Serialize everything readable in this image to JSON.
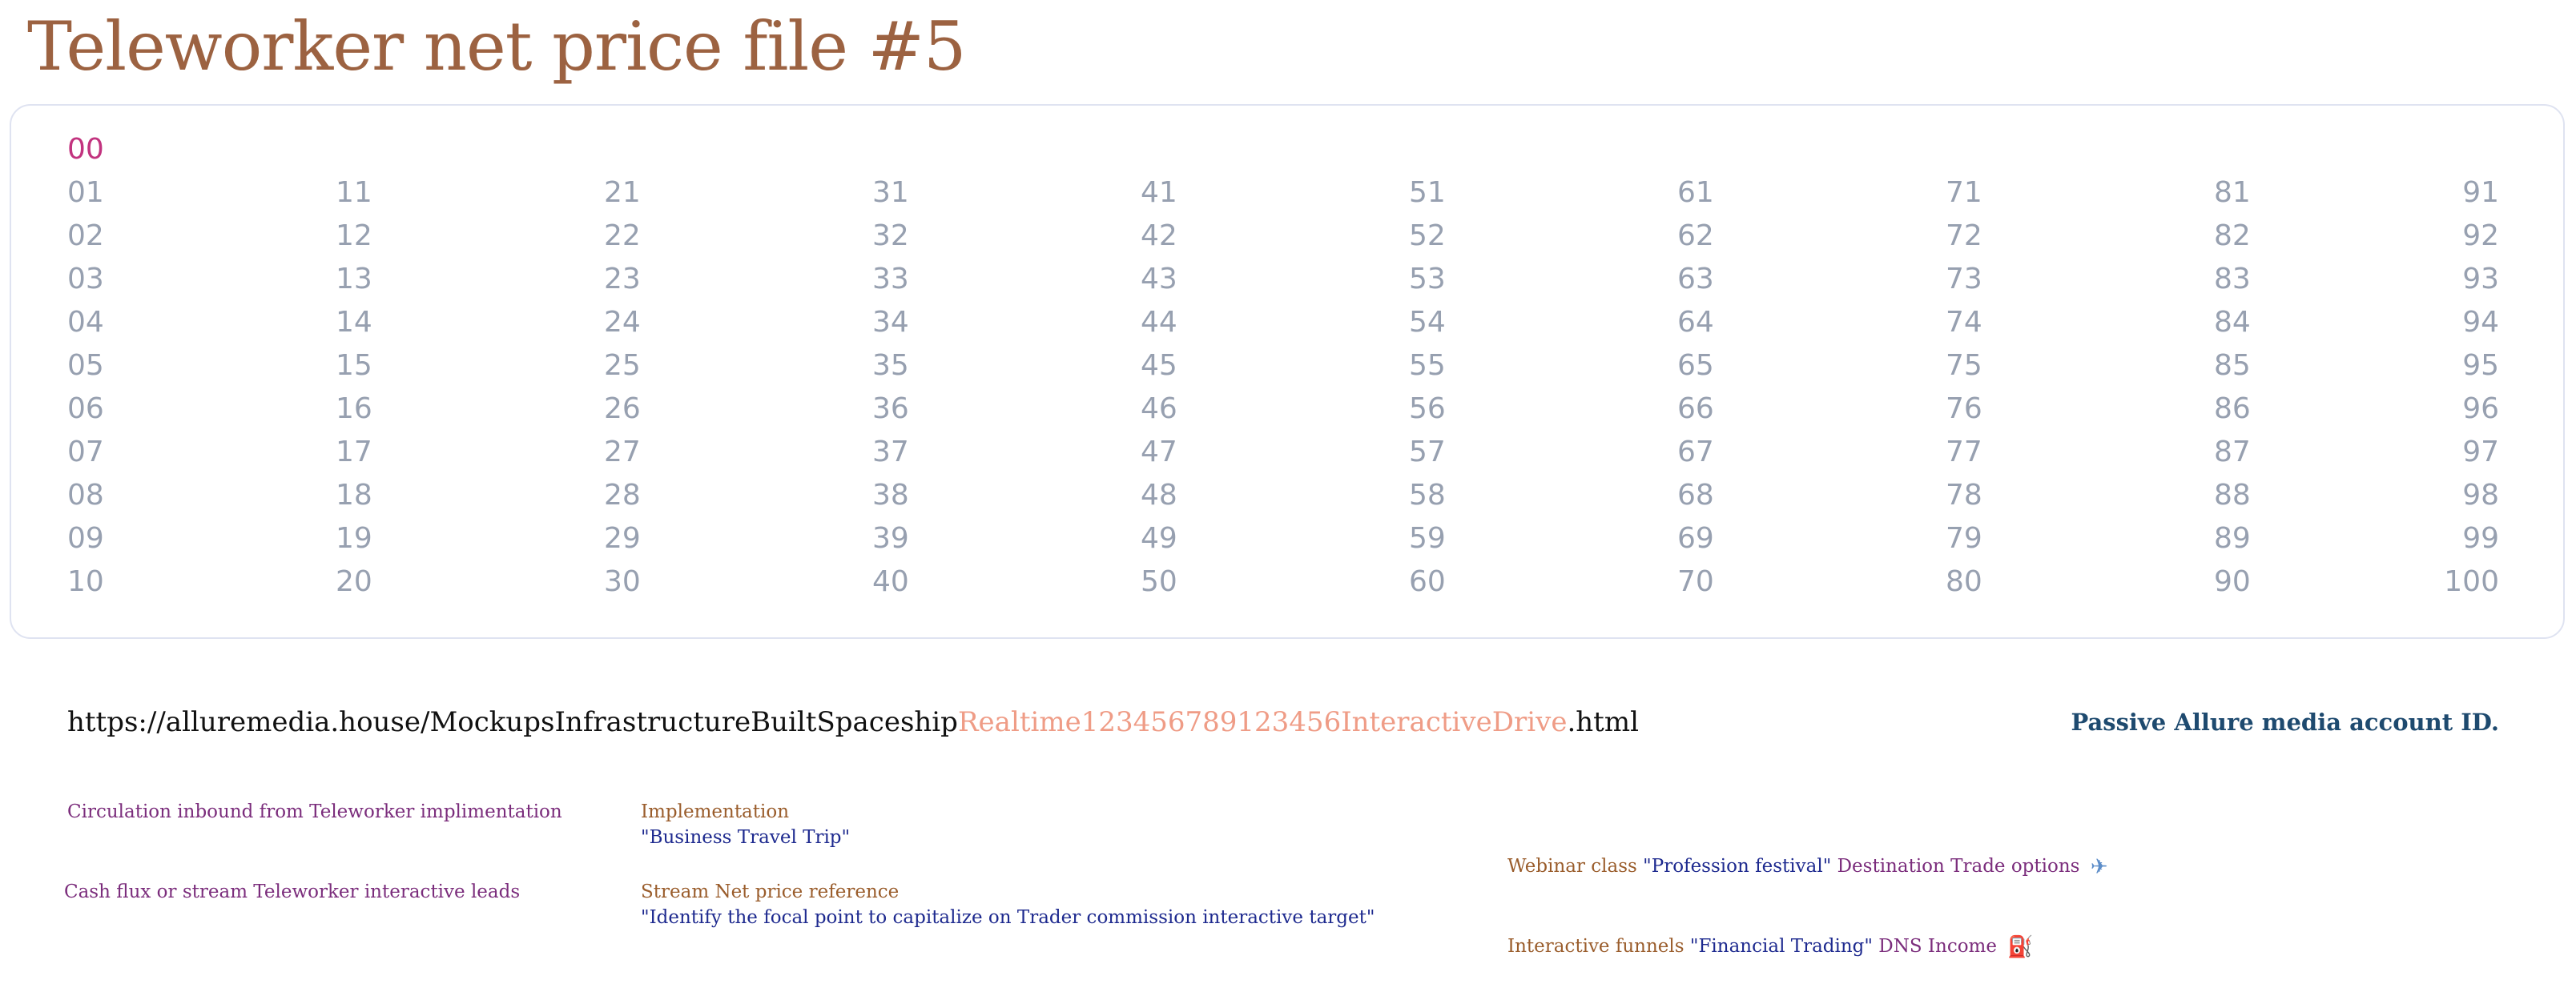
{
  "page": {
    "title": "Teleworker net price file #5"
  },
  "colors": {
    "title": "#9c6241",
    "highlight_number": "#c2337f",
    "number": "#97a0b0",
    "card_border": "#dfe3f1",
    "url_text": "#111111",
    "url_highlight": "#ef9c86",
    "account_link": "#1e4a6f",
    "purple": "#7b2d7c",
    "brown": "#9a5d2c",
    "navy": "#1e2a8f",
    "emoji_red": "#c8282f",
    "emoji_blue": "#5c8dc9"
  },
  "number_grid": {
    "highlighted": "00",
    "columns": [
      [
        "01",
        "02",
        "03",
        "04",
        "05",
        "06",
        "07",
        "08",
        "09",
        "10"
      ],
      [
        "11",
        "12",
        "13",
        "14",
        "15",
        "16",
        "17",
        "18",
        "19",
        "20"
      ],
      [
        "21",
        "22",
        "23",
        "24",
        "25",
        "26",
        "27",
        "28",
        "29",
        "30"
      ],
      [
        "31",
        "32",
        "33",
        "34",
        "35",
        "36",
        "37",
        "38",
        "39",
        "40"
      ],
      [
        "41",
        "42",
        "43",
        "44",
        "45",
        "46",
        "47",
        "48",
        "49",
        "50"
      ],
      [
        "51",
        "52",
        "53",
        "54",
        "55",
        "56",
        "57",
        "58",
        "59",
        "60"
      ],
      [
        "61",
        "62",
        "63",
        "64",
        "65",
        "66",
        "67",
        "68",
        "69",
        "70"
      ],
      [
        "71",
        "72",
        "73",
        "74",
        "75",
        "76",
        "77",
        "78",
        "79",
        "80"
      ],
      [
        "81",
        "82",
        "83",
        "84",
        "85",
        "86",
        "87",
        "88",
        "89",
        "90"
      ],
      [
        "91",
        "92",
        "93",
        "94",
        "95",
        "96",
        "97",
        "98",
        "99",
        "100"
      ]
    ]
  },
  "url": {
    "prefix": "https://alluremedia.house/MockupsInfrastructureBuiltSpaceship",
    "highlight": "Realtime123456789123456InteractiveDrive",
    "suffix": ".html"
  },
  "account": {
    "label": "Passive Allure media account ID."
  },
  "leads": [
    "Circulation inbound from Teleworker implimentation",
    "Cash flux or stream Teleworker interactive leads"
  ],
  "details": [
    {
      "label": "Implementation",
      "value": "\"Business Travel Trip\""
    },
    {
      "label": "Stream Net price reference",
      "value": "\"Identify the focal point to capitalize on Trader commission interactive target\""
    }
  ],
  "offers": [
    {
      "prefix": "Webinar class",
      "quote": "\"Profession festival\"",
      "suffix": "Destination Trade options",
      "icon": "airplane-icon",
      "glyph": "✈"
    },
    {
      "prefix": "Interactive funnels",
      "quote": "\"Financial Trading\"",
      "suffix": "DNS Income",
      "icon": "fuel-pump-icon",
      "glyph": "⛽"
    }
  ]
}
